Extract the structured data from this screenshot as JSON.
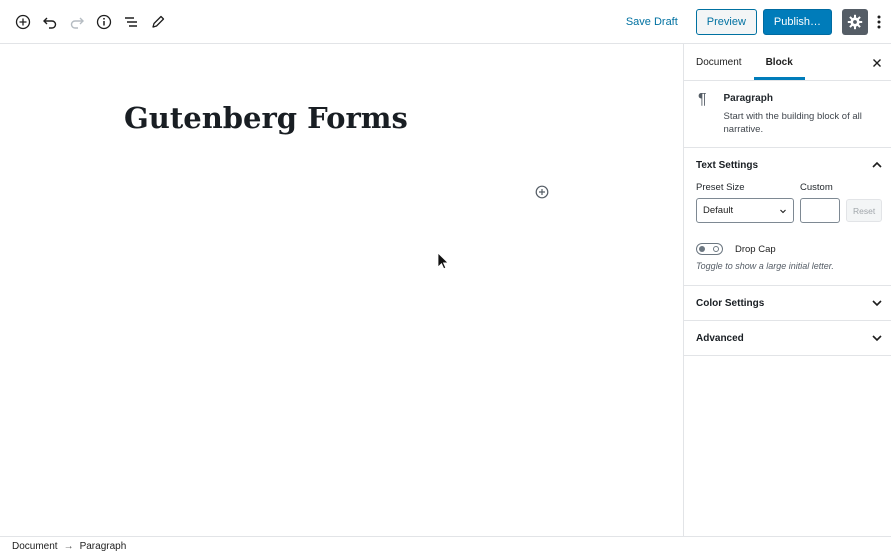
{
  "toolbar": {
    "icons": [
      "add-block-icon",
      "undo-icon",
      "redo-icon",
      "info-icon",
      "outline-icon",
      "tools-icon"
    ],
    "save_draft": "Save Draft",
    "preview": "Preview",
    "publish": "Publish…",
    "settings_icon": "gear-icon",
    "more_icon": "more-vertical-icon"
  },
  "editor": {
    "title": "Gutenberg Forms"
  },
  "sidebar": {
    "tabs": [
      {
        "label": "Document",
        "active": false
      },
      {
        "label": "Block",
        "active": true
      }
    ],
    "block": {
      "name": "Paragraph",
      "description": "Start with the building block of all narrative."
    },
    "text_settings": {
      "title": "Text Settings",
      "preset_label": "Preset Size",
      "preset_value": "Default",
      "custom_label": "Custom",
      "custom_value": "",
      "reset_label": "Reset",
      "drop_cap_label": "Drop Cap",
      "drop_cap_help": "Toggle to show a large initial letter.",
      "drop_cap_on": false
    },
    "color_settings": {
      "title": "Color Settings"
    },
    "advanced": {
      "title": "Advanced"
    }
  },
  "footer": {
    "breadcrumbs": [
      "Document",
      "Paragraph"
    ]
  },
  "colors": {
    "accent": "#007cba",
    "link": "#0071a1",
    "settings_bg": "#555d66"
  }
}
